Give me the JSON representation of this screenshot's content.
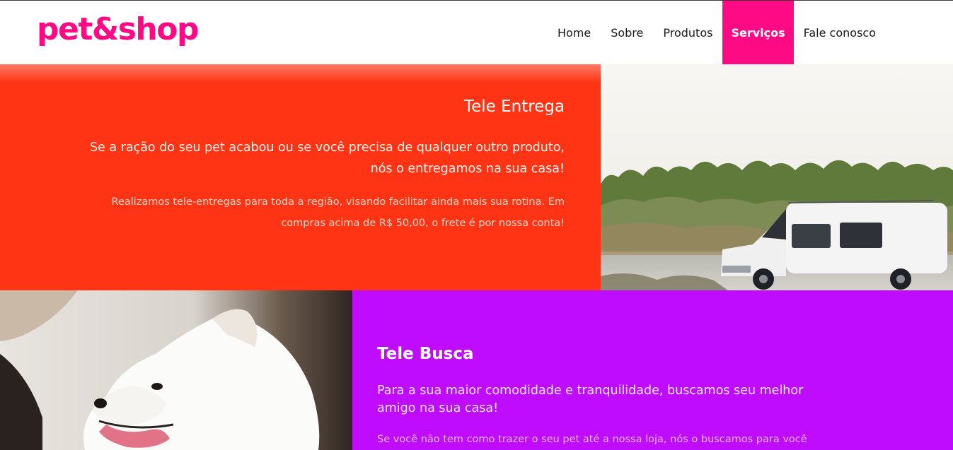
{
  "colors": {
    "brand": "#ff0a85",
    "orange_panel": "#ff3414",
    "purple_panel": "#bf0cff"
  },
  "header": {
    "logo": "pet&shop",
    "nav": [
      {
        "label": "Home",
        "active": false
      },
      {
        "label": "Sobre",
        "active": false
      },
      {
        "label": "Produtos",
        "active": false
      },
      {
        "label": "Serviços",
        "active": true
      },
      {
        "label": "Fale conosco",
        "active": false
      }
    ]
  },
  "services": {
    "tele_entrega": {
      "title": "Tele Entrega",
      "lead": "Se a ração do seu pet acabou ou se você precisa de qualquer outro produto, nós o entregamos na sua casa!",
      "body": "Realizamos tele-entregas para toda a região, visando facilitar ainda mais sua rotina. Em compras acima de R$ 50,00, o frete é por nossa conta!",
      "image": "white-van-photo"
    },
    "tele_busca": {
      "title": "Tele Busca",
      "lead": "Para a sua maior comodidade e tranquilidade, buscamos seu melhor amigo na sua casa!",
      "body": "Se você não tem como trazer o seu pet até a nossa loja, nós o buscamos para você",
      "image": "white-dog-photo"
    }
  }
}
